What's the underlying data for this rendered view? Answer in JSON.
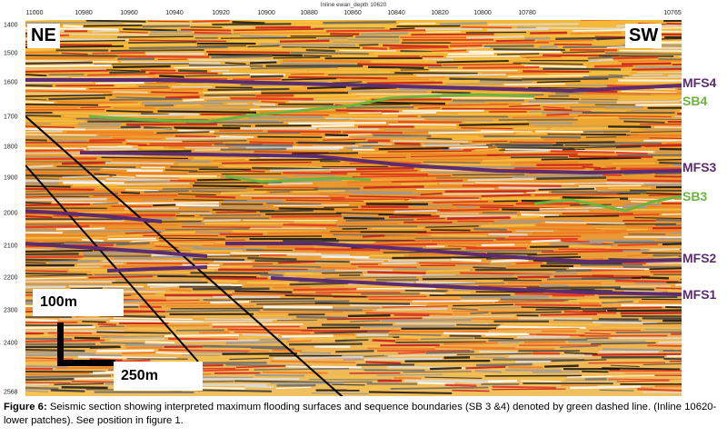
{
  "header": {
    "title": "Inline ewan_depth 10620"
  },
  "x_ticks": [
    "11000",
    "10980",
    "10960",
    "10940",
    "10920",
    "10900",
    "10880",
    "10860",
    "10840",
    "10820",
    "10800",
    "10780",
    "10765"
  ],
  "y_ticks": [
    "1400",
    "1500",
    "1600",
    "1700",
    "1800",
    "1900",
    "2000",
    "2100",
    "2200",
    "2300",
    "2400",
    "2568"
  ],
  "directions": {
    "left": "NE",
    "right": "SW"
  },
  "horizons": {
    "mfs4": "MFS4",
    "sb4": "SB4",
    "mfs3": "MFS3",
    "sb3": "SB3",
    "mfs2": "MFS2",
    "mfs1": "MFS1"
  },
  "colors": {
    "mfs": "#5b2c6f",
    "sb": "#6cb33f",
    "fault": "#000000"
  },
  "scale": {
    "vertical": "100m",
    "horizontal": "250m"
  },
  "caption": {
    "prefix": "Figure 6:",
    "text": " Seismic section showing interpreted maximum flooding surfaces and sequence boundaries (SB 3 &4) denoted by green dashed line. (Inline 10620- lower patches).  See position in figure 1."
  }
}
